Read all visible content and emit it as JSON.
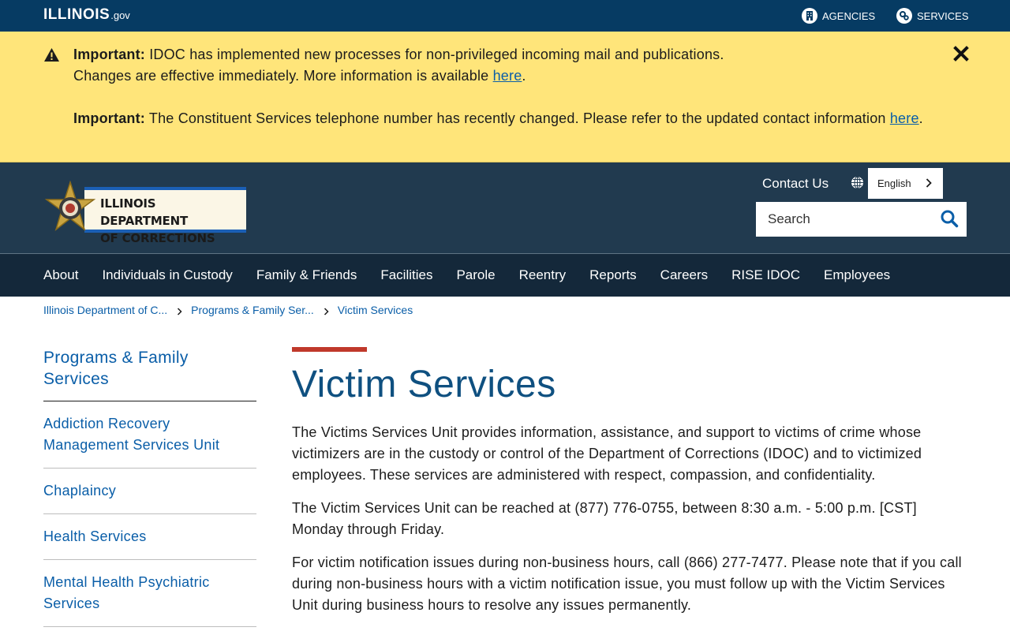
{
  "gov_bar": {
    "logo_main": "ILLINOIS",
    "logo_suffix": ".gov",
    "agencies_label": "AGENCIES",
    "services_label": "SERVICES"
  },
  "alert": {
    "line1_strong": "Important:",
    "line1_text": " IDOC has implemented new processes for non-privileged incoming mail and publications.",
    "line2_text": "Changes are effective immediately. More information is available ",
    "line2_link": "here",
    "line2_end": ".",
    "line3_strong": "Important:",
    "line3_text": " The Constituent Services telephone number has recently changed. Please refer to the updated contact information ",
    "line3_link": "here",
    "line3_end": "."
  },
  "agency": {
    "name_line1": "ILLINOIS DEPARTMENT",
    "name_line2": "OF CORRECTIONS",
    "contact_us": "Contact Us",
    "language": "English",
    "search_placeholder": "Search"
  },
  "nav": {
    "items": [
      "About",
      "Individuals in Custody",
      "Family & Friends",
      "Facilities",
      "Parole",
      "Reentry",
      "Reports",
      "Careers",
      "RISE IDOC",
      "Employees"
    ]
  },
  "breadcrumb": {
    "items": [
      "Illinois Department of C...",
      "Programs & Family Ser...",
      "Victim Services"
    ]
  },
  "sidebar": {
    "heading": "Programs & Family Services",
    "items": [
      "Addiction Recovery Management Services Unit",
      "Chaplaincy",
      "Health Services",
      "Mental Health Psychiatric Services"
    ]
  },
  "content": {
    "title": "Victim Services",
    "paragraphs": [
      "The Victims Services Unit provides information, assistance, and support to victims of crime whose victimizers are in the custody or control of the Department of Corrections (IDOC) and to victimized employees. These services are administered with respect, compassion, and confidentiality.",
      "The Victim Services Unit can be reached at (877) 776-0755, between 8:30 a.m. - 5:00 p.m. [CST] Monday through Friday.",
      "For victim notification issues during non-business hours, call (866) 277-7477. Please note that if you call during non-business hours with a victim notification issue, you must follow up with the Victim Services Unit during business hours to resolve any issues permanently."
    ]
  },
  "colors": {
    "gov_bar": "#063b63",
    "alert_bg": "#ffe57a",
    "agency_header": "#213a4f",
    "nav_bg": "#14283a",
    "link": "#0a5ea8",
    "title": "#0f5080",
    "title_accent": "#c0392b"
  },
  "icons": {
    "warning": "warning-icon",
    "close": "close-icon",
    "agencies": "building-icon",
    "services": "gear-icon",
    "globe": "globe-icon",
    "search": "search-icon"
  }
}
